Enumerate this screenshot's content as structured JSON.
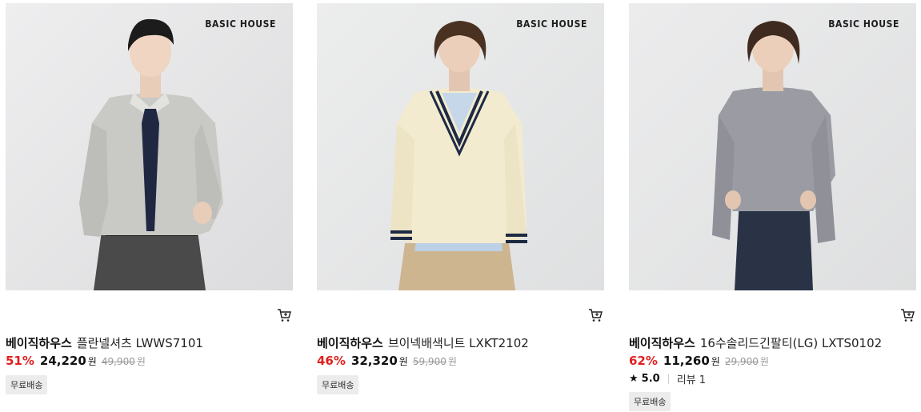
{
  "products": [
    {
      "brand_mark": "BASIC HOUSE",
      "brand": "베이직하우스",
      "name": "플란넬셔츠 LWWS7101",
      "discount": "51%",
      "price": "24,220",
      "currency": "원",
      "original_price": "49,900",
      "original_currency": "원",
      "badge": "무료배송",
      "image_icon": "product-photo-shirt-tie"
    },
    {
      "brand_mark": "BASIC HOUSE",
      "brand": "베이직하우스",
      "name": "브이넥배색니트 LXKT2102",
      "discount": "46%",
      "price": "32,320",
      "currency": "원",
      "original_price": "59,900",
      "original_currency": "원",
      "badge": "무료배송",
      "image_icon": "product-photo-vneck-knit"
    },
    {
      "brand_mark": "BASIC HOUSE",
      "brand": "베이직하우스",
      "name": "16수솔리드긴팔티(LG) LXTS0102",
      "discount": "62%",
      "price": "11,260",
      "currency": "원",
      "original_price": "29,900",
      "original_currency": "원",
      "rating": {
        "star": "★",
        "score": "5.0",
        "reviews": "리뷰 1"
      },
      "badge": "무료배송",
      "image_icon": "product-photo-longsleeve-tee"
    }
  ],
  "colors": {
    "discount": "#e02020",
    "badge_bg": "#ececec",
    "photo_bg": "#e9eaec"
  }
}
